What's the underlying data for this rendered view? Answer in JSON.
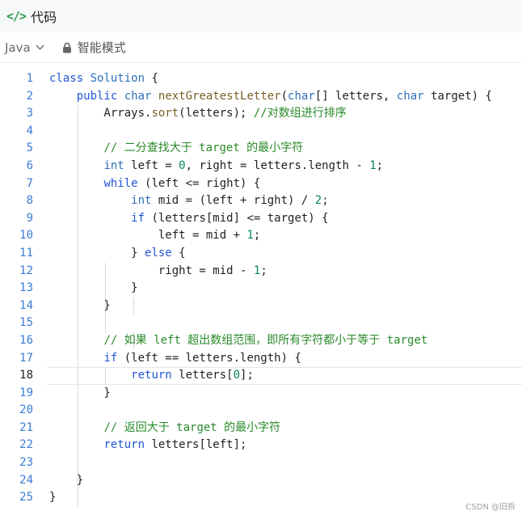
{
  "header": {
    "icon": "code-icon",
    "title": "代码"
  },
  "toolbar": {
    "language": "Java",
    "mode": "智能模式"
  },
  "editor": {
    "current_line": 18,
    "lines": [
      {
        "n": "1",
        "tokens": [
          [
            "kw",
            "class"
          ],
          [
            "op",
            " "
          ],
          [
            "ty",
            "Solution"
          ],
          [
            "op",
            " {"
          ]
        ]
      },
      {
        "n": "2",
        "tokens": [
          [
            "op",
            "    "
          ],
          [
            "kw",
            "public"
          ],
          [
            "op",
            " "
          ],
          [
            "ty",
            "char"
          ],
          [
            "op",
            " "
          ],
          [
            "fn",
            "nextGreatestLetter"
          ],
          [
            "op",
            "("
          ],
          [
            "ty",
            "char"
          ],
          [
            "op",
            "[] letters, "
          ],
          [
            "ty",
            "char"
          ],
          [
            "op",
            " target) {"
          ]
        ]
      },
      {
        "n": "3",
        "tokens": [
          [
            "op",
            "        Arrays."
          ],
          [
            "fn",
            "sort"
          ],
          [
            "op",
            "(letters); "
          ],
          [
            "cm",
            "//对数组进行排序"
          ]
        ]
      },
      {
        "n": "4",
        "tokens": []
      },
      {
        "n": "5",
        "tokens": [
          [
            "op",
            "        "
          ],
          [
            "cm",
            "// 二分查找大于 target 的最小字符"
          ]
        ]
      },
      {
        "n": "6",
        "tokens": [
          [
            "op",
            "        "
          ],
          [
            "ty",
            "int"
          ],
          [
            "op",
            " left = "
          ],
          [
            "num",
            "0"
          ],
          [
            "op",
            ", right = letters.length - "
          ],
          [
            "num",
            "1"
          ],
          [
            "op",
            ";"
          ]
        ]
      },
      {
        "n": "7",
        "tokens": [
          [
            "op",
            "        "
          ],
          [
            "kw",
            "while"
          ],
          [
            "op",
            " (left <= right) {"
          ]
        ]
      },
      {
        "n": "8",
        "tokens": [
          [
            "op",
            "            "
          ],
          [
            "ty",
            "int"
          ],
          [
            "op",
            " mid = (left + right) / "
          ],
          [
            "num",
            "2"
          ],
          [
            "op",
            ";"
          ]
        ]
      },
      {
        "n": "9",
        "tokens": [
          [
            "op",
            "            "
          ],
          [
            "kw",
            "if"
          ],
          [
            "op",
            " (letters[mid] <= target) {"
          ]
        ]
      },
      {
        "n": "10",
        "tokens": [
          [
            "op",
            "                left = mid + "
          ],
          [
            "num",
            "1"
          ],
          [
            "op",
            ";"
          ]
        ]
      },
      {
        "n": "11",
        "tokens": [
          [
            "op",
            "            } "
          ],
          [
            "kw",
            "else"
          ],
          [
            "op",
            " {"
          ]
        ]
      },
      {
        "n": "12",
        "tokens": [
          [
            "op",
            "                right = mid - "
          ],
          [
            "num",
            "1"
          ],
          [
            "op",
            ";"
          ]
        ]
      },
      {
        "n": "13",
        "tokens": [
          [
            "op",
            "            }"
          ]
        ]
      },
      {
        "n": "14",
        "tokens": [
          [
            "op",
            "        }"
          ]
        ]
      },
      {
        "n": "15",
        "tokens": []
      },
      {
        "n": "16",
        "tokens": [
          [
            "op",
            "        "
          ],
          [
            "cm",
            "// 如果 left 超出数组范围，即所有字符都小于等于 target"
          ]
        ]
      },
      {
        "n": "17",
        "tokens": [
          [
            "op",
            "        "
          ],
          [
            "kw",
            "if"
          ],
          [
            "op",
            " (left == letters.length) {"
          ]
        ]
      },
      {
        "n": "18",
        "tokens": [
          [
            "op",
            "            "
          ],
          [
            "kw",
            "return"
          ],
          [
            "op",
            " letters["
          ],
          [
            "num",
            "0"
          ],
          [
            "op",
            "];"
          ]
        ]
      },
      {
        "n": "19",
        "tokens": [
          [
            "op",
            "        }"
          ]
        ]
      },
      {
        "n": "20",
        "tokens": []
      },
      {
        "n": "21",
        "tokens": [
          [
            "op",
            "        "
          ],
          [
            "cm",
            "// 返回大于 target 的最小字符"
          ]
        ]
      },
      {
        "n": "22",
        "tokens": [
          [
            "op",
            "        "
          ],
          [
            "kw",
            "return"
          ],
          [
            "op",
            " letters[left];"
          ]
        ]
      },
      {
        "n": "23",
        "tokens": []
      },
      {
        "n": "24",
        "tokens": [
          [
            "op",
            "    }"
          ]
        ]
      },
      {
        "n": "25",
        "tokens": [
          [
            "op",
            "}"
          ]
        ]
      }
    ]
  },
  "watermark": "CSDN @旧拆"
}
